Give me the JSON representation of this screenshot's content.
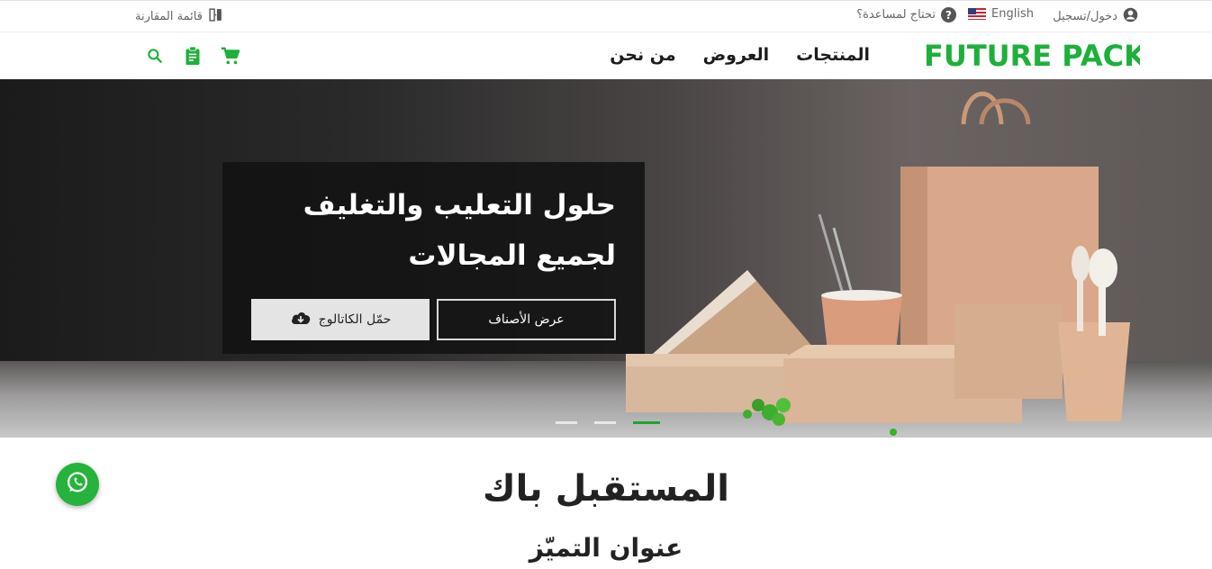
{
  "topbar": {
    "login": "دخول/تسجيل",
    "language": "English",
    "help": "تحتاج لمساعدة؟",
    "compare": "قائمة المقارنة"
  },
  "logo": {
    "text": "FUTURE PACK",
    "color": "#1db03a"
  },
  "nav": {
    "links": [
      "المنتجات",
      "العروض",
      "من نحن"
    ],
    "icons": [
      "cart-icon",
      "clipboard-icon",
      "search-icon"
    ]
  },
  "hero": {
    "title_line1": "حلول التعليب والتغليف",
    "title_line2": "لجميع المجالات",
    "view_categories": "عرض الأصناف",
    "download_catalog": "حمّل الكاتالوج",
    "slides": 3,
    "active_slide": 3
  },
  "about": {
    "title": "المستقبل باك",
    "subtitle": "عنوان التميّز"
  },
  "colors": {
    "brand_green": "#1db03a",
    "whatsapp": "#25b33c"
  }
}
